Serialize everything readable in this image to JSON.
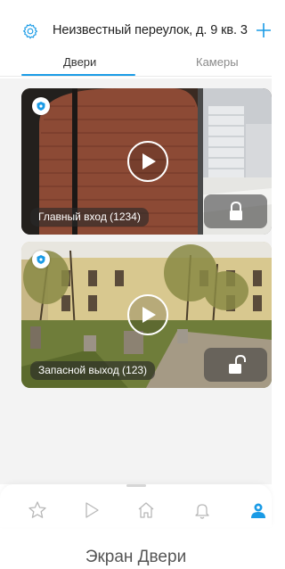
{
  "header": {
    "address": "Неизвестный переулок, д. 9 кв. 3",
    "settings_icon": "gear-icon",
    "add_icon": "plus-icon"
  },
  "tabs": [
    {
      "label": "Двери",
      "active": true
    },
    {
      "label": "Камеры",
      "active": false
    }
  ],
  "doors": [
    {
      "name": "Главный вход (1234)",
      "lock_state": "locked",
      "lock_icon": "lock-closed-icon"
    },
    {
      "name": "Запасной выход (123)",
      "lock_state": "unlocked",
      "lock_icon": "lock-open-icon"
    }
  ],
  "bottom_nav": [
    {
      "name": "favorites",
      "icon": "star-icon",
      "active": false
    },
    {
      "name": "video",
      "icon": "play-icon",
      "active": false
    },
    {
      "name": "home",
      "icon": "home-icon",
      "active": false
    },
    {
      "name": "notifications",
      "icon": "bell-icon",
      "active": false
    },
    {
      "name": "profile",
      "icon": "user-icon",
      "active": true
    }
  ],
  "caption": "Экран Двери",
  "colors": {
    "accent": "#1a9be6",
    "content_bg": "#f3f3f3",
    "inactive_text": "#8a8a8a"
  }
}
